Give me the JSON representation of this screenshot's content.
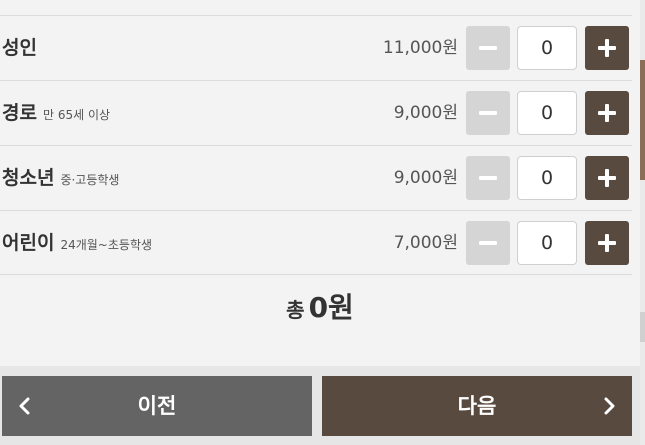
{
  "tickets": [
    {
      "name": "성인",
      "sub": "",
      "price": "11,000원",
      "qty": "0"
    },
    {
      "name": "경로",
      "sub": "만 65세 이상",
      "price": "9,000원",
      "qty": "0"
    },
    {
      "name": "청소년",
      "sub": "중·고등학생",
      "price": "9,000원",
      "qty": "0"
    },
    {
      "name": "어린이",
      "sub": "24개월~초등학생",
      "price": "7,000원",
      "qty": "0"
    }
  ],
  "total": {
    "label": "총",
    "amount": "0원"
  },
  "nav": {
    "prev_label": "이전",
    "next_label": "다음"
  },
  "colors": {
    "accent": "#584a3f",
    "minus_button": "#d5d5d5",
    "prev_button": "#646464",
    "background": "#f3f3f3"
  },
  "icons": {
    "minus": "minus-icon",
    "plus": "plus-icon",
    "prev": "chevron-left-icon",
    "next": "chevron-right-icon"
  }
}
